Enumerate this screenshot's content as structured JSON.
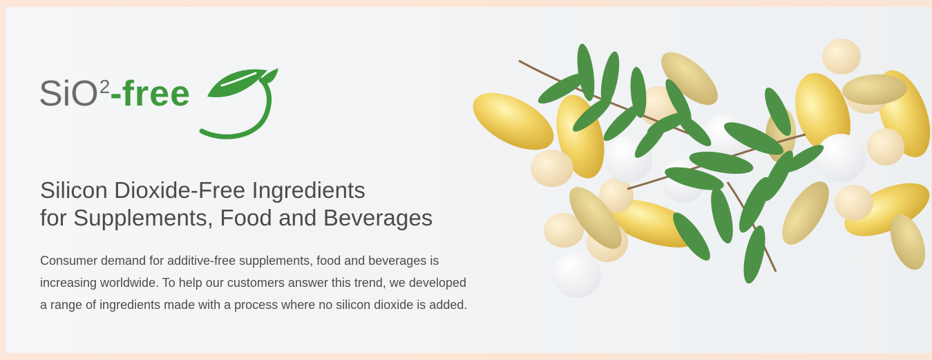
{
  "logo": {
    "prefix": "SiO",
    "superscript": "2",
    "dash": "-",
    "highlight": "free",
    "icon": "leaf-sprout-icon"
  },
  "hero": {
    "headline_line1": "Silicon Dioxide-Free Ingredients",
    "headline_line2": "for Supplements, Food and Beverages",
    "description": "Consumer demand for additive-free supplements, food and beverages is increasing worldwide. To help our customers answer this trend, we developed a range of ingredients made with a process where no silicon dioxide is added."
  },
  "image": {
    "subject": "supplement-capsules-and-tablets-with-leaves"
  },
  "colors": {
    "brand_green": "#3c9a3d",
    "text_gray": "#4b4b4b",
    "page_bg": "#fbe6d6",
    "banner_bg": "#f1f3f5"
  }
}
